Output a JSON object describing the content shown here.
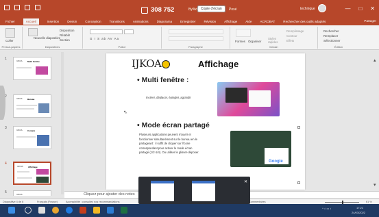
{
  "titlebar": {
    "counter": "308 752",
    "filename": "By%de...",
    "snippet": "Copie d'écran",
    "filename_tail": "Posé",
    "user": "technique",
    "min": "—",
    "max": "□",
    "close": "✕"
  },
  "menu": {
    "items": [
      "Fichier",
      "Accueil",
      "Insertion",
      "Dessin",
      "Conception",
      "Transitions",
      "Animations",
      "Diaporama",
      "Enregistrer",
      "Révision",
      "Affichage",
      "Aide",
      "ACROBAT",
      "Rechercher des outils adaptés"
    ],
    "active_index": 1,
    "share": "Partager"
  },
  "ribbon": {
    "paste": "Coller",
    "new_slide": "Nouvelle diapositive",
    "layout": "Disposition",
    "reset": "Rétablir",
    "section": "Section",
    "font_buttons": "G  I  S  ab  AV  Aa",
    "shapes": "Formes",
    "arrange": "Organiser",
    "quick_styles": "Styles rapides",
    "fill": "Remplissage",
    "outline": "Contour",
    "effects": "Effets",
    "find": "Rechercher",
    "replace": "Remplacer",
    "select": "Sélectionner",
    "groups": [
      "Presse-papiers",
      "Diapositives",
      "Police",
      "Paragraphe",
      "Dessin",
      "Édition"
    ]
  },
  "thumbnails": [
    {
      "num": "1",
      "title": "Multi fenêtre",
      "logo": "IJKOA"
    },
    {
      "num": "2",
      "title": "Bureau",
      "logo": "IJKOA"
    },
    {
      "num": "3",
      "title": "Compte",
      "logo": "IJKOA"
    },
    {
      "num": "4",
      "title": "Affichage",
      "logo": "IJKOA"
    },
    {
      "num": "5",
      "title": "",
      "logo": "IJKOA"
    }
  ],
  "slide": {
    "logo": "IJKOA",
    "title": "Affichage",
    "bullet1": "• Multi fenêtre :",
    "body1": "Incérer, déplacer, épingler, agrandir",
    "bullet2": "• Mode écran partagé",
    "body2_lines": [
      "Plusieurs applications peuvent s'ouvrir et",
      "fonctionner simultanément sur le bureau en le",
      "partageant : il suffit de cliquer sur l'icone",
      "correspondant pour activer le mode écran",
      "partagé (1/2-1/4). Ou utiliser le glisser-déposer."
    ],
    "google": "Google"
  },
  "notes": {
    "placeholder": "Cliquez pour ajouter des notes"
  },
  "status": {
    "slide": "Diapositive 4 de 6",
    "language": "Français (France)",
    "accessibility": "Accessibilité : consultez nos recommandations",
    "comments": "Commentaires",
    "zoom": "61 %"
  },
  "tray": {
    "time": "17:21",
    "date": "24/03/2022"
  }
}
